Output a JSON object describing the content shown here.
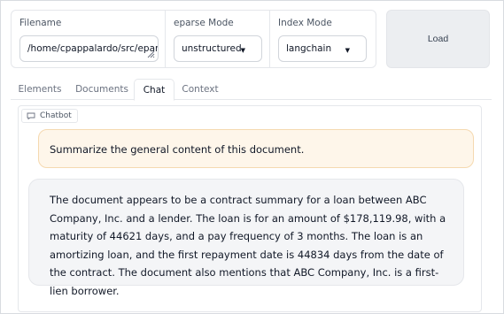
{
  "inputs": {
    "filename": {
      "label": "Filename",
      "value": "/home/cpappalardo/src/eparse/tests"
    },
    "eparse_mode": {
      "label": "eparse Mode",
      "value": "unstructured"
    },
    "index_mode": {
      "label": "Index Mode",
      "value": "langchain"
    },
    "load_label": "Load"
  },
  "tabs": [
    {
      "label": "Elements"
    },
    {
      "label": "Documents"
    },
    {
      "label": "Chat",
      "active": true
    },
    {
      "label": "Context"
    }
  ],
  "chatbot": {
    "label": "Chatbot",
    "messages": [
      {
        "role": "user",
        "text": "Summarize the general content of this document."
      },
      {
        "role": "assistant",
        "text": "The document appears to be a contract summary for a loan between ABC Company, Inc. and a lender. The loan is for an amount of $178,119.98, with a maturity of 44621 days, and a pay frequency of 3 months. The loan is an amortizing loan, and the first repayment date is 44834 days from the date of the contract. The document also mentions that ABC Company, Inc. is a first-lien borrower."
      }
    ]
  },
  "colors": {
    "user_bubble": "#fef6ea",
    "user_border": "#f5d9b0",
    "bot_bubble": "#f4f5f7",
    "button_bg": "#eceef1"
  },
  "icons": {
    "dropdown": "chevron-down-icon",
    "resize": "resize-handle-icon",
    "chatbot": "chat-bubble-icon"
  }
}
